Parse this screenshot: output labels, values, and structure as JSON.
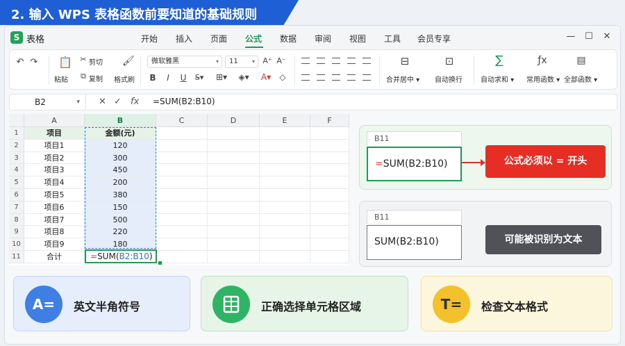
{
  "banner": {
    "title": "2. 输入 WPS 表格函数前要知道的基础规则"
  },
  "app": {
    "logo": "S",
    "name": "表格"
  },
  "menu": {
    "tabs": [
      "开始",
      "插入",
      "页面",
      "公式",
      "数据",
      "审阅",
      "视图",
      "工具",
      "会员专享"
    ],
    "active": "公式"
  },
  "ribbon": {
    "cut": "剪切",
    "paste": "粘贴",
    "copy": "复制",
    "format_painter": "格式刷",
    "font": "微软雅黑",
    "size": "11",
    "merge": "合并居中",
    "wrap": "自动换行",
    "autosum": "自动求和",
    "common_funcs": "常用函数",
    "all_funcs": "全部函数"
  },
  "formula_bar": {
    "name_box": "B2",
    "formula": "=SUM(B2:B10)",
    "fx": "fx"
  },
  "sheet": {
    "columns": [
      "A",
      "B",
      "C",
      "D",
      "E",
      "F"
    ],
    "rows": [
      "1",
      "2",
      "3",
      "4",
      "5",
      "6",
      "7",
      "8",
      "9",
      "10",
      "11"
    ],
    "header": {
      "a": "项目",
      "b": "金额(元)"
    },
    "data": [
      {
        "a": "项目1",
        "b": "120"
      },
      {
        "a": "项目2",
        "b": "300"
      },
      {
        "a": "项目3",
        "b": "450"
      },
      {
        "a": "项目4",
        "b": "200"
      },
      {
        "a": "项目5",
        "b": "380"
      },
      {
        "a": "项目6",
        "b": "150"
      },
      {
        "a": "项目7",
        "b": "500"
      },
      {
        "a": "项目8",
        "b": "220"
      },
      {
        "a": "项目9",
        "b": "180"
      }
    ],
    "total_label": "合计",
    "total_formula": {
      "eq": "=",
      "fn": "SUM(",
      "ref": "B2:B10",
      "close": ")"
    }
  },
  "example_correct": {
    "cell": "B11",
    "eq": "=",
    "text": "SUM(B2:B10)",
    "note": "公式必须以 = 开头"
  },
  "example_wrong": {
    "cell": "B11",
    "text": "SUM(B2:B10)",
    "note": "可能被识别为文本"
  },
  "tips": [
    {
      "icon": "A=",
      "text": "英文半角符号"
    },
    {
      "icon": "",
      "text": "正确选择单元格区域"
    },
    {
      "icon": "T=",
      "text": "检查文本格式"
    }
  ],
  "colors": {
    "accent_green": "#1d9a55",
    "alert_red": "#e72e25",
    "banner_blue": "#1f5fd6"
  }
}
